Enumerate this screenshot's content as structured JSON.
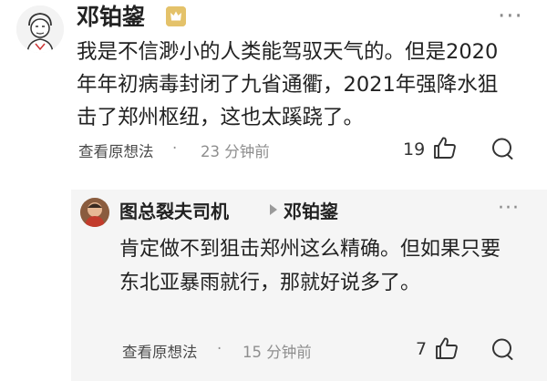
{
  "comment": {
    "author": "邓铂鋆",
    "text": "我是不信渺小的人类能驾驭天气的。但是2020年年初病毒封闭了九省通衢，2021年强降水狙击了郑州枢纽，这也太蹊跷了。",
    "view_thoughts": "查看原想法",
    "time": "23 分钟前",
    "likes": "19"
  },
  "reply": {
    "author": "图总裂夫司机",
    "reply_to": "邓铂鋆",
    "text": "肯定做不到狙击郑州这么精确。但如果只要东北亚暴雨就行，那就好说多了。",
    "view_thoughts": "查看原想法",
    "time": "15 分钟前",
    "likes": "7"
  },
  "separator": "·",
  "more_glyph": "···",
  "icons": {
    "badge": "verified-badge-icon",
    "like": "thumbs-up-icon",
    "comment": "comment-bubble-icon",
    "more": "more-options-icon"
  },
  "colors": {
    "reply_background": "#f5f5f5",
    "badge": "#e4c26a",
    "secondary_text": "#8e8e8e"
  }
}
